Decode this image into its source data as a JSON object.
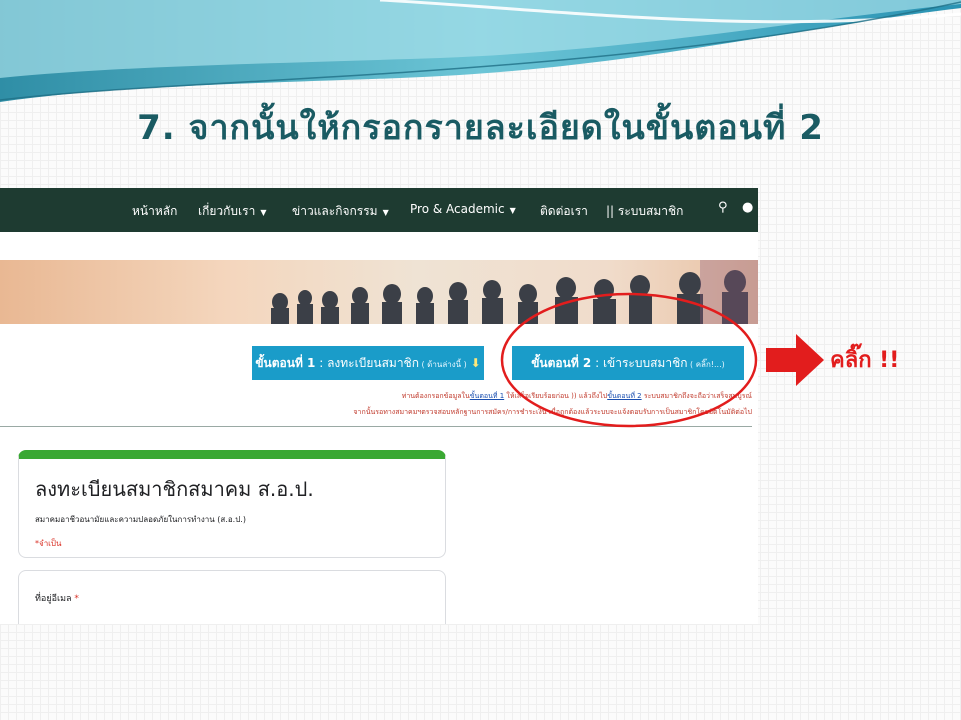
{
  "slide": {
    "title": "7. จากนั้นให้กรอกรายละเอียดในขั้นตอนที่ 2",
    "callout_label": "คลิ๊ก !!",
    "accent_color": "#e21d1d",
    "title_color": "#1a5b63"
  },
  "nav": {
    "items": [
      {
        "label": "หน้าหลัก",
        "has_dropdown": false
      },
      {
        "label": "เกี่ยวกับเรา",
        "has_dropdown": true
      },
      {
        "label": "ข่าวและกิจกรรม",
        "has_dropdown": true
      },
      {
        "label": "Pro & Academic",
        "has_dropdown": true
      },
      {
        "label": "ติดต่อเรา",
        "has_dropdown": false
      },
      {
        "label": "|| ระบบสมาชิก",
        "has_dropdown": false
      }
    ],
    "caret": "▼",
    "search_icon": "⚲",
    "user_icon": "●",
    "background": "#1e3b31"
  },
  "steps": {
    "step1": {
      "prefix": "ขั้นตอนที่ 1",
      "text": " : ลงทะเบียนสมาชิก",
      "note": " ( ด้านล่างนี้ )",
      "hint": " ⬇"
    },
    "step2": {
      "prefix": "ขั้นตอนที่ 2",
      "text": " : เข้าระบบสมาชิก",
      "note": " ( คลิ๊ก!...)"
    },
    "button_color": "#1a9cc9"
  },
  "info": {
    "line1_a": "ท่านต้องกรอกข้อมูลใน",
    "line1_link1": "ขั้นตอนที่ 1",
    "line1_b": " ให้เสร็จเรียบร้อยก่อน )) แล้วถึงไป",
    "line1_link2": "ขั้นตอนที่ 2",
    "line1_c": " ระบบสมาชิกถึงจะถือว่าเสร็จสมบูรณ์",
    "line2": "จากนั้นรอทางสมาคมฯตรวจสอบหลักฐานการสมัคร/การชำระเงิน เมื่อถูกต้องแล้วระบบจะแจ้งตอบรับการเป็นสมาชิกโดยอัตโนมัติต่อไป"
  },
  "form": {
    "title": "ลงทะเบียนสมาชิกสมาคม ส.อ.ป.",
    "description": "สมาคมอาชีวอนามัยและความปลอดภัยในการทำงาน (ส.อ.ป.)",
    "required_note": "*จำเป็น",
    "header_color": "#3aa833",
    "fields": [
      {
        "label": "ที่อยู่อีเมล",
        "required_mark": " *"
      }
    ]
  }
}
